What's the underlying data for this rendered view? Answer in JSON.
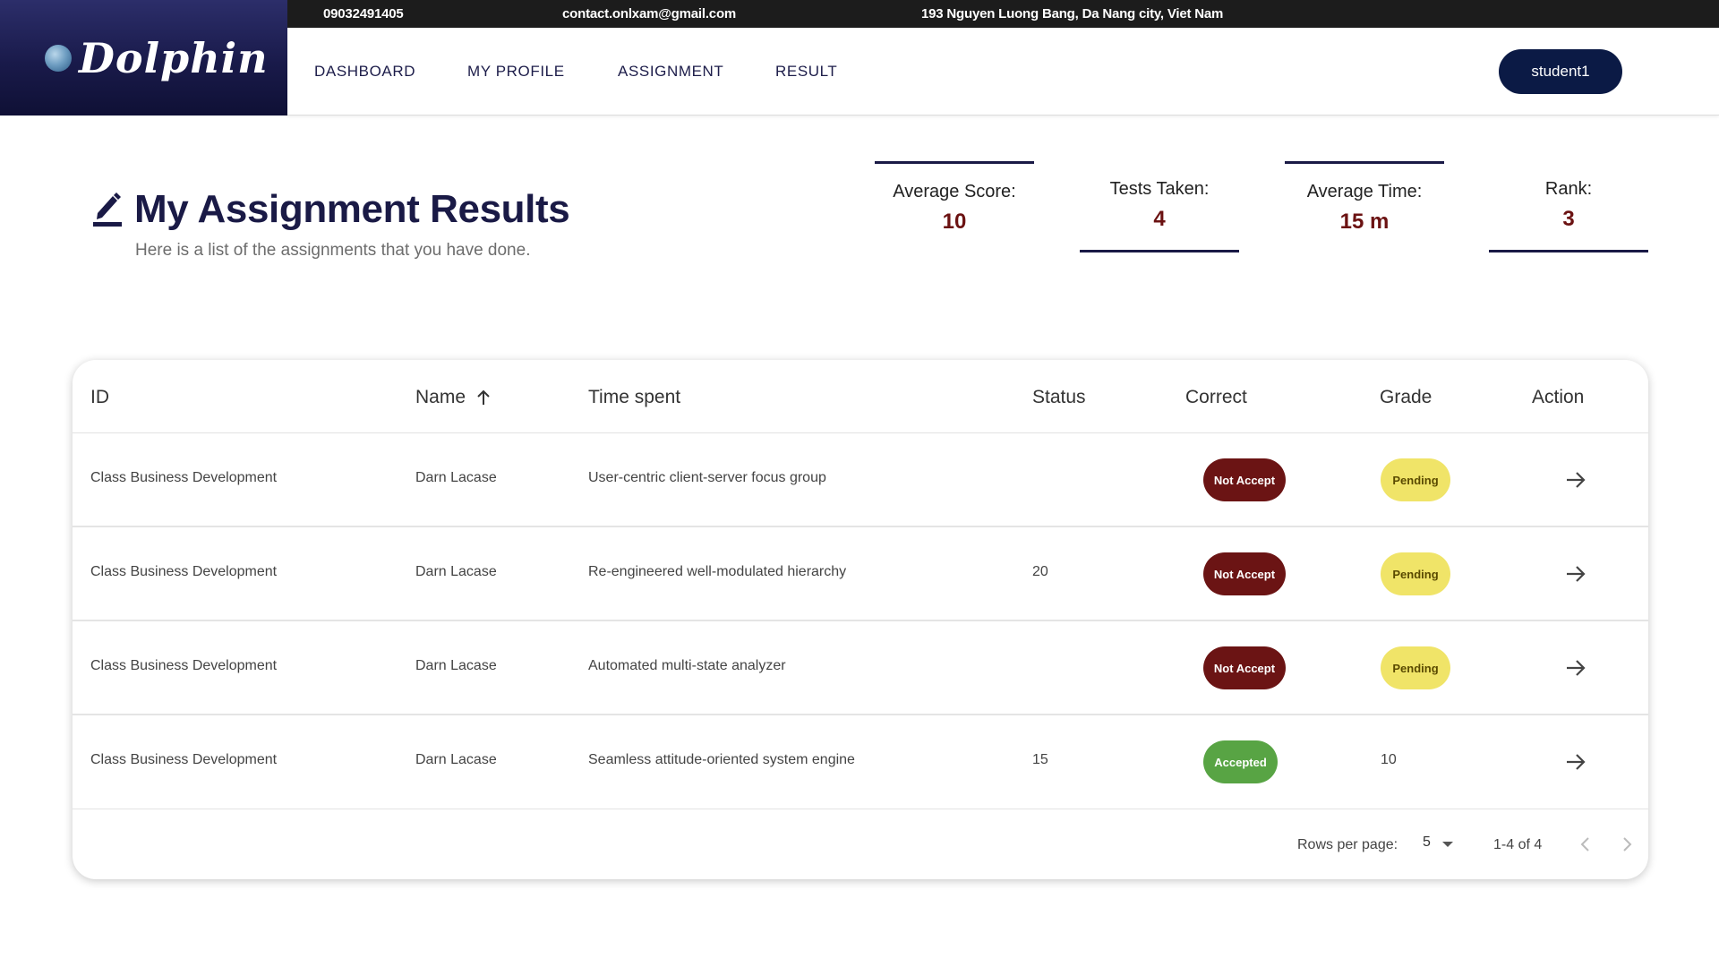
{
  "topbar": {
    "phone": "09032491405",
    "email": "contact.onlxam@gmail.com",
    "address": "193 Nguyen Luong Bang, Da Nang city, Viet Nam"
  },
  "logo": {
    "brand": "Dolphin"
  },
  "nav": {
    "items": [
      {
        "label": "DASHBOARD"
      },
      {
        "label": "MY PROFILE"
      },
      {
        "label": "ASSIGNMENT"
      },
      {
        "label": "RESULT"
      }
    ],
    "user_button": "student1"
  },
  "page": {
    "title": "My Assignment Results",
    "subtitle": "Here is a list of the assignments that you have done."
  },
  "stats": [
    {
      "label": "Average Score:",
      "value": "10"
    },
    {
      "label": "Tests Taken:",
      "value": "4"
    },
    {
      "label": "Average Time:",
      "value": "15 m"
    },
    {
      "label": "Rank:",
      "value": "3"
    }
  ],
  "table": {
    "columns": [
      "ID",
      "Name",
      "Time spent",
      "Status",
      "Correct",
      "Grade",
      "Action"
    ],
    "rows": [
      {
        "id": "Class Business Development",
        "name": "Darn Lacase",
        "time_spent": "User-centric client-server focus group",
        "status": "",
        "correct": "Not Accept",
        "grade": "Pending"
      },
      {
        "id": "Class Business Development",
        "name": "Darn Lacase",
        "time_spent": "Re-engineered well-modulated hierarchy",
        "status": "20",
        "correct": "Not Accept",
        "grade": "Pending"
      },
      {
        "id": "Class Business Development",
        "name": "Darn Lacase",
        "time_spent": "Automated multi-state analyzer",
        "status": "",
        "correct": "Not Accept",
        "grade": "Pending"
      },
      {
        "id": "Class Business Development",
        "name": "Darn Lacase",
        "time_spent": "Seamless attitude-oriented system engine",
        "status": "15",
        "correct": "Accepted",
        "grade": "10"
      }
    ],
    "footer": {
      "rows_per_page_label": "Rows per page:",
      "rows_per_page_value": "5",
      "range": "1-4 of 4"
    }
  },
  "colors": {
    "brand_navy": "#1a1a46",
    "button_navy": "#0b1a45",
    "stat_value": "#6b1212",
    "not_accept_chip": "#6b1414",
    "accepted_chip": "#58a444",
    "pending_chip": "#f0e468"
  },
  "icons": {
    "logo": "globe-icon",
    "title": "edit-pencil-icon",
    "sort": "arrow-up-icon",
    "action": "arrow-right-icon",
    "pagination_prev": "chevron-left-icon",
    "pagination_next": "chevron-right-icon",
    "select": "caret-down-icon"
  }
}
